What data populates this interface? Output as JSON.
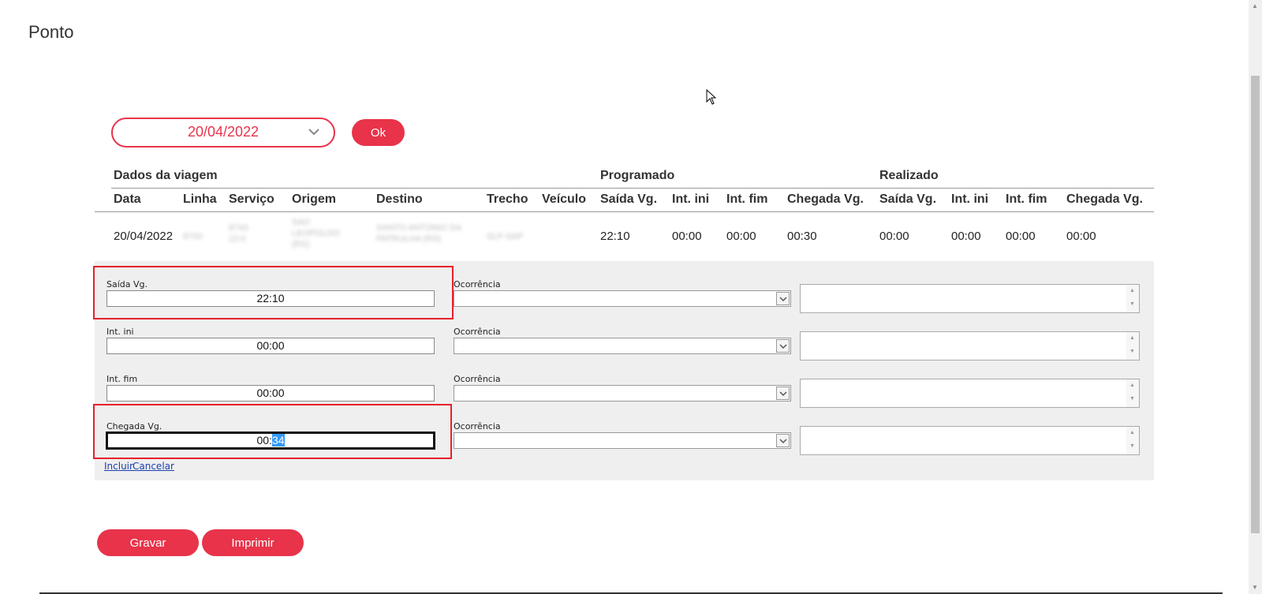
{
  "page": {
    "title": "Ponto"
  },
  "filter": {
    "date": "20/04/2022",
    "ok_label": "Ok"
  },
  "groups": {
    "trip": "Dados da viagem",
    "scheduled": "Programado",
    "actual": "Realizado"
  },
  "columns": [
    "Data",
    "Linha",
    "Serviço",
    "Origem",
    "Destino",
    "Trecho",
    "Veículo",
    "Saída Vg.",
    "Int. ini",
    "Int. fim",
    "Chegada Vg.",
    "Saída Vg.",
    "Int. ini",
    "Int. fim",
    "Chegada Vg."
  ],
  "row": {
    "data": "20/04/2022",
    "linha": "8743",
    "servico": "8743 22:0",
    "origem": "SAO LEOPOLDO (RS)",
    "destino": "SANTO ANTONIO DA PATRULHA (RS)",
    "trecho": "SLP-SAP",
    "veiculo": "",
    "prog_saida": "22:10",
    "prog_int_ini": "00:00",
    "prog_int_fim": "00:00",
    "prog_chegada": "00:30",
    "real_saida": "00:00",
    "real_int_ini": "00:00",
    "real_int_fim": "00:00",
    "real_chegada": "00:00"
  },
  "edit": {
    "fields": [
      {
        "label": "Saída Vg.",
        "value": "22:10",
        "occurrence_label": "Ocorrência",
        "occurrence_value": "",
        "note": ""
      },
      {
        "label": "Int. ini",
        "value": "00:00",
        "occurrence_label": "Ocorrência",
        "occurrence_value": "",
        "note": ""
      },
      {
        "label": "Int. fim",
        "value": "00:00",
        "occurrence_label": "Ocorrência",
        "occurrence_value": "",
        "note": ""
      },
      {
        "label": "Chegada Vg.",
        "value_prefix": "00:",
        "value_selected": "34",
        "occurrence_label": "Ocorrência",
        "occurrence_value": "",
        "note": ""
      }
    ],
    "include_label": "Incluir",
    "cancel_label": "Cancelar"
  },
  "actions": {
    "save_label": "Gravar",
    "print_label": "Imprimir"
  },
  "colors": {
    "accent": "#e8334a",
    "highlight": "#e8202a",
    "selection": "#3399ff"
  }
}
